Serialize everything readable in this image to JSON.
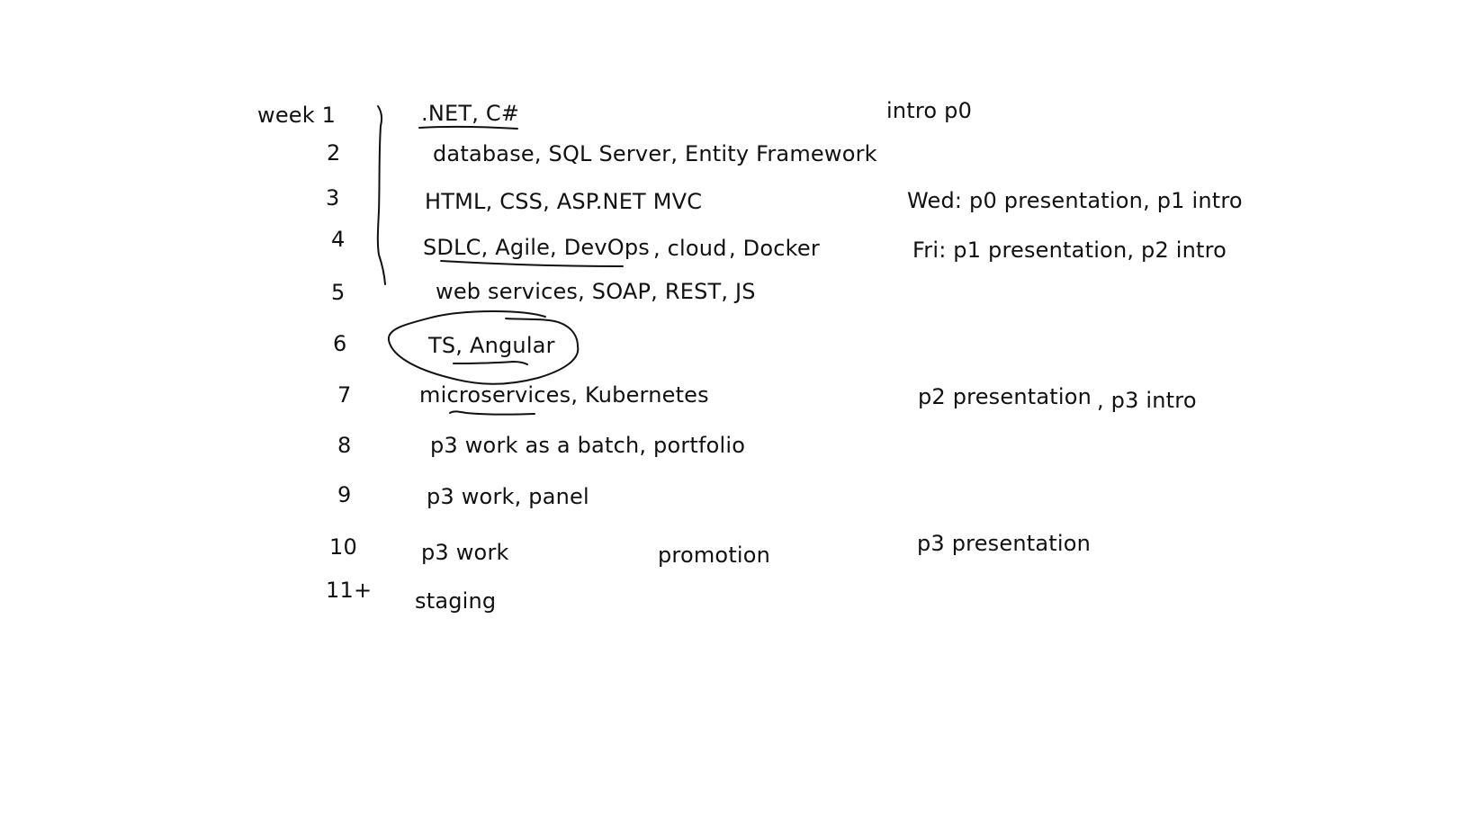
{
  "notes": {
    "week_labels": [
      "week 1",
      "2",
      "3",
      "4",
      "5",
      "6",
      "7",
      "8",
      "9",
      "10",
      "11+"
    ],
    "topics": [
      ".NET, C#",
      "database, SQL Server, Entity Framework",
      "HTML, CSS, ASP.NET MVC",
      "SDLC, Agile, DevOps",
      ", cloud",
      ", Docker",
      "web services, SOAP, REST, JS",
      "TS, Angular",
      "microservices, Kubernetes",
      "p3 work as a batch, portfolio",
      "p3 work, panel",
      "p3 work",
      "promotion",
      "staging"
    ],
    "events": [
      "intro p0",
      "Wed: p0 presentation, p1 intro",
      "Fri: p1 presentation, p2 intro",
      "p2 presentation",
      ", p3 intro",
      "p3 presentation"
    ]
  }
}
